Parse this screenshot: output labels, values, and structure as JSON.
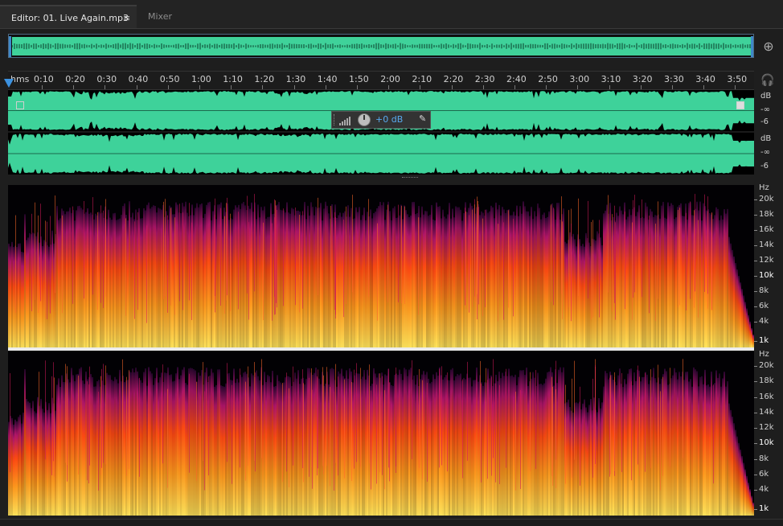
{
  "tabs": {
    "editor_label": "Editor: 01. Live Again.mp3",
    "editor_menu": "≡",
    "mixer_label": "Mixer"
  },
  "ruler": {
    "unit": "hms",
    "labels": [
      "0:10",
      "0:20",
      "0:30",
      "0:40",
      "0:50",
      "1:00",
      "1:10",
      "1:20",
      "1:30",
      "1:40",
      "1:50",
      "2:00",
      "2:10",
      "2:20",
      "2:30",
      "2:40",
      "2:50",
      "3:00",
      "3:10",
      "3:20",
      "3:30",
      "3:40",
      "3:50"
    ]
  },
  "volume_hud": {
    "value": "+0 dB"
  },
  "db_scale": {
    "top": {
      "unit": "dB",
      "marks": [
        "-∞",
        "-6"
      ]
    },
    "bottom": {
      "unit": "dB",
      "marks": [
        "-∞",
        "-6"
      ]
    }
  },
  "hz_scale": {
    "unit": "Hz",
    "labels": [
      "20k",
      "18k",
      "16k",
      "14k",
      "12k",
      "10k",
      "8k",
      "6k",
      "4k",
      "1k"
    ]
  },
  "colors": {
    "waveform": "#3ed29a",
    "accent": "#3c92e0",
    "spectral_low": "#ffe35a",
    "spectral_mid": "#ff4a12",
    "spectral_high": "#b0156a"
  }
}
